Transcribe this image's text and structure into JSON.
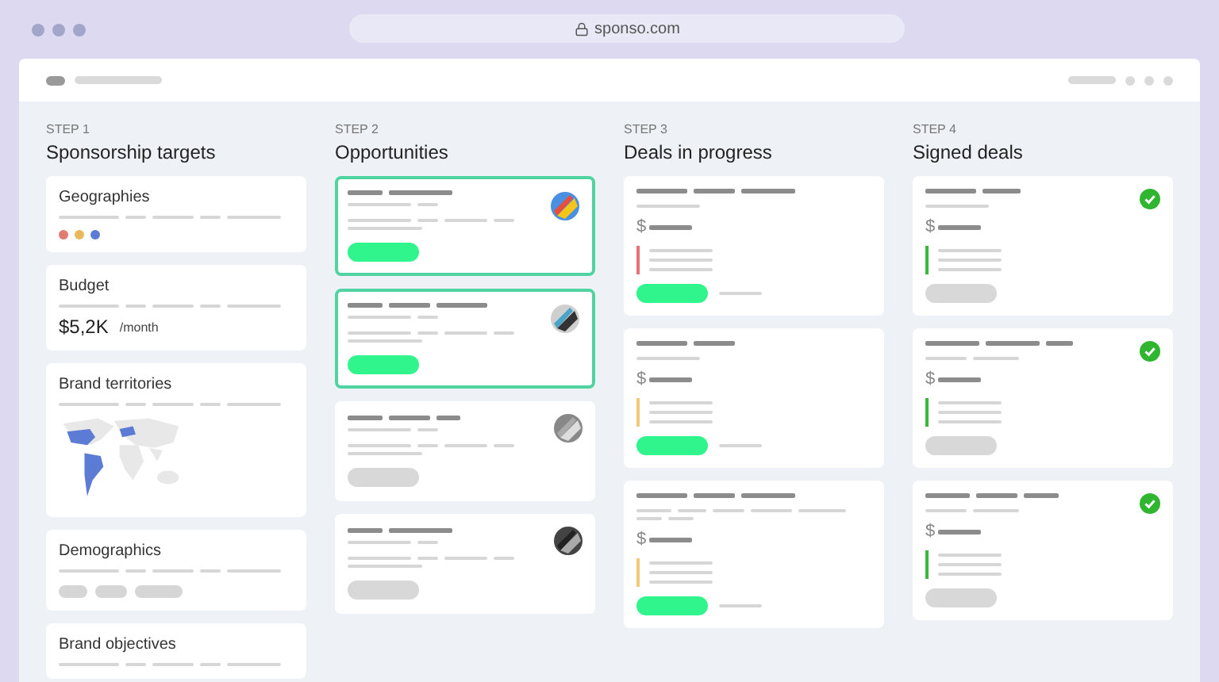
{
  "browser": {
    "url": "sponso.com"
  },
  "columns": [
    {
      "kind": "targets",
      "step": "STEP 1",
      "title": "Sponsorship targets",
      "cards": [
        {
          "kind": "dots",
          "title": "Geographies",
          "dots": [
            {
              "color": "#e27c72"
            },
            {
              "color": "#e8b95a"
            },
            {
              "color": "#5b7bd4"
            }
          ]
        },
        {
          "kind": "budget",
          "title": "Budget",
          "amount": "$5,2K",
          "unit": "/month"
        },
        {
          "kind": "map",
          "title": "Brand territories"
        },
        {
          "kind": "chips",
          "title": "Demographics"
        },
        {
          "kind": "plain",
          "title": "Brand objectives"
        }
      ]
    },
    {
      "kind": "opportunities",
      "step": "STEP 2",
      "title": "Opportunities",
      "cards": [
        {
          "selected": true
        },
        {
          "selected": true
        },
        {
          "selected": false
        },
        {
          "selected": false
        }
      ]
    },
    {
      "kind": "deals",
      "step": "STEP 3",
      "title": "Deals in progress",
      "cards": [
        {
          "currency": "$",
          "color": "#e57373"
        },
        {
          "currency": "$",
          "color": "#f2c97a"
        },
        {
          "currency": "$",
          "color": "#f2c97a"
        }
      ]
    },
    {
      "kind": "signed",
      "step": "STEP 4",
      "title": "Signed deals",
      "cards": [
        {
          "currency": "$",
          "signed": true
        },
        {
          "currency": "$",
          "signed": true
        },
        {
          "currency": "$",
          "signed": true
        }
      ]
    }
  ]
}
